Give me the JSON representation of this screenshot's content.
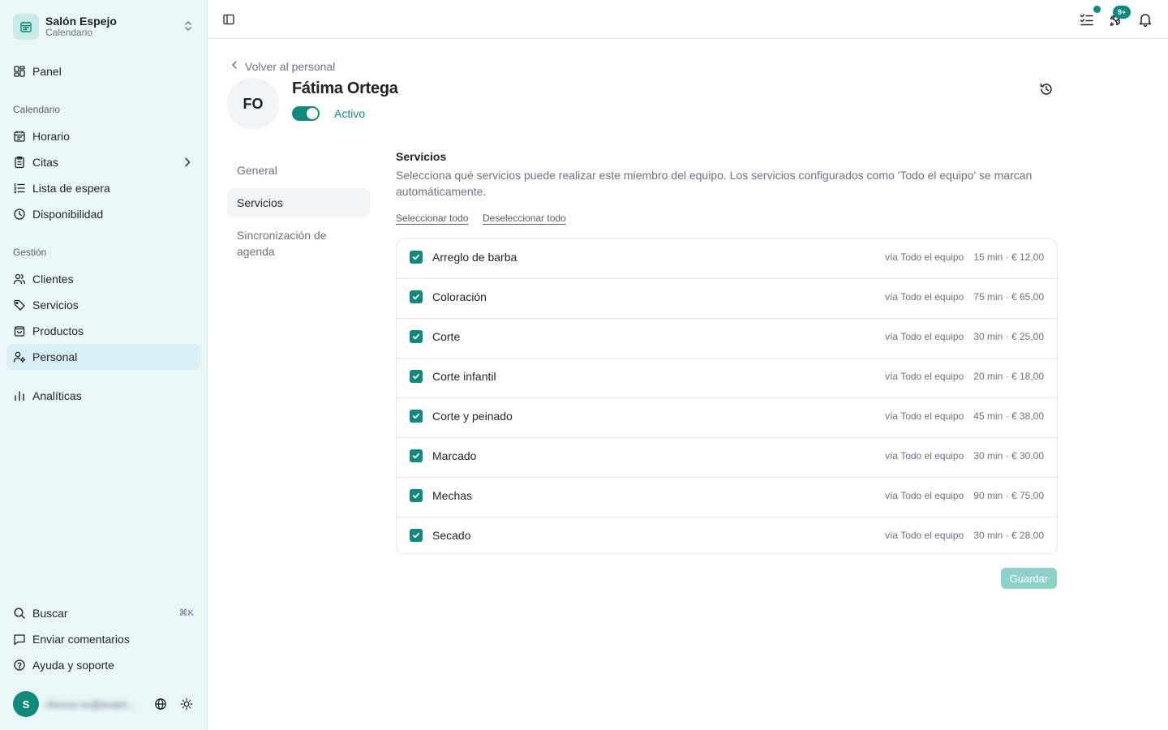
{
  "brand": {
    "name": "Salón Espejo",
    "subtitle": "Calendario",
    "accent": "#0f8a7a"
  },
  "sidebar": {
    "panel": "Panel",
    "section_calendar": "Calendario",
    "calendar_items": [
      "Horario",
      "Citas",
      "Lista de espera",
      "Disponibilidad"
    ],
    "section_management": "Gestión",
    "management_items": [
      "Clientes",
      "Servicios",
      "Productos",
      "Personal"
    ],
    "analytics": "Analíticas",
    "search": "Buscar",
    "search_shortcut": "⌘K",
    "feedback": "Enviar comentarios",
    "help": "Ayuda y soporte",
    "user_initial": "S",
    "user_email": "ckxxxx-xx@exam..."
  },
  "topbar": {
    "notifications_badge": "9+"
  },
  "profile": {
    "back_label": "Volver al personal",
    "initials": "FO",
    "name": "Fátima Ortega",
    "status": "Activo"
  },
  "tabs": [
    "General",
    "Servicios",
    "Sincronización de agenda"
  ],
  "services_section": {
    "title": "Servicios",
    "description": "Selecciona qué servicios puede realizar este miembro del equipo. Los servicios configurados como 'Todo el equipo' se marcan automáticamente.",
    "select_all": "Seleccionar todo",
    "deselect_all": "Deseleccionar todo",
    "save": "Guardar"
  },
  "services": [
    {
      "name": "Arreglo de barba",
      "via": "vía Todo el equipo",
      "detail": "15 min · € 12,00",
      "checked": true
    },
    {
      "name": "Coloración",
      "via": "vía Todo el equipo",
      "detail": "75 min · € 65,00",
      "checked": true
    },
    {
      "name": "Corte",
      "via": "vía Todo el equipo",
      "detail": "30 min · € 25,00",
      "checked": true
    },
    {
      "name": "Corte infantil",
      "via": "vía Todo el equipo",
      "detail": "20 min · € 18,00",
      "checked": true
    },
    {
      "name": "Corte y peinado",
      "via": "vía Todo el equipo",
      "detail": "45 min · € 38,00",
      "checked": true
    },
    {
      "name": "Marcado",
      "via": "vía Todo el equipo",
      "detail": "30 min · € 30,00",
      "checked": true
    },
    {
      "name": "Mechas",
      "via": "vía Todo el equipo",
      "detail": "90 min · € 75,00",
      "checked": true
    },
    {
      "name": "Secado",
      "via": "vía Todo el equipo",
      "detail": "30 min · € 28,00",
      "checked": true
    }
  ]
}
